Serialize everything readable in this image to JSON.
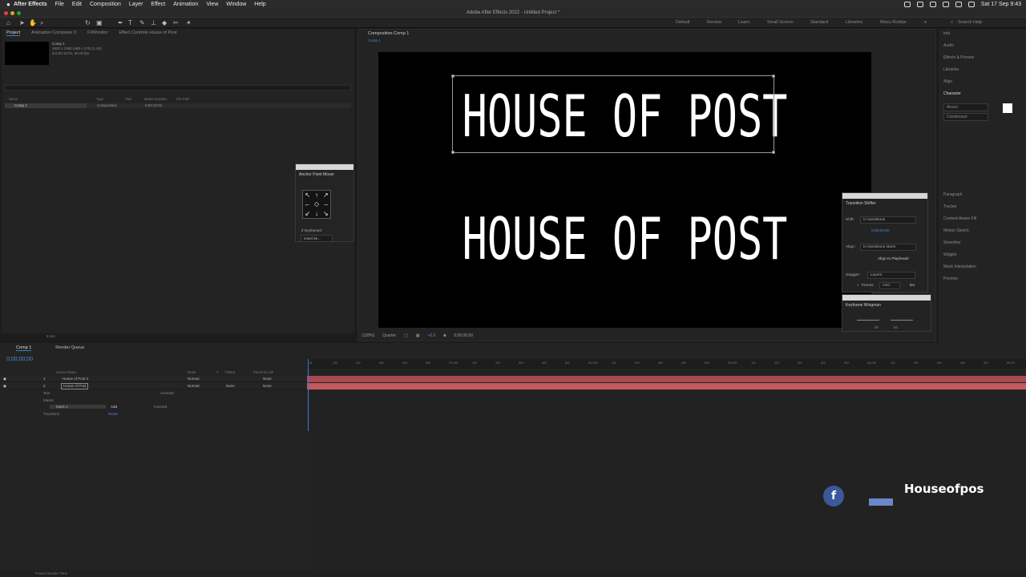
{
  "menubar": {
    "app": "After Effects",
    "items": [
      "File",
      "Edit",
      "Composition",
      "Layer",
      "Effect",
      "Animation",
      "View",
      "Window",
      "Help"
    ],
    "date": "Sat 17 Sep 9:43"
  },
  "window": {
    "title": "Adobe After Effects 2022 - Untitled Project *"
  },
  "workspaces": [
    "Default",
    "Review",
    "Learn",
    "Small Screen",
    "Standard",
    "Libraries",
    "Manu Roldán"
  ],
  "search_help": "Search Help",
  "project": {
    "tabs": [
      "Project",
      "Animation Composer 3",
      "FXMonitor",
      "Effect Controls House of Post"
    ],
    "item_name": "Comp 1",
    "meta1": "1920 x 1080 (480 x 270) (1,00)",
    "meta2": "Δ 0:00:10:01, 60,00 fps",
    "columns": [
      "Name",
      "Type",
      "Size",
      "Media Duration",
      "File Path"
    ],
    "row": {
      "name": "Comp 1",
      "type": "Composition",
      "duration": "0:00:10:01"
    },
    "bpc": "8 bpc"
  },
  "anchor_mover": {
    "title": "Anchor Point Mover",
    "label": "If keyframed:",
    "select": "Insert ke..."
  },
  "composition": {
    "tab": "Composition Comp 1",
    "subtab": "Comp 1",
    "text_top": "HOUSE OF POST",
    "text_bottom": "HOUSE OF POST",
    "zoom": "(128%)",
    "resolution": "Quarter",
    "exposure": "+0,0",
    "timecode": "0;00;00;00"
  },
  "shifter": {
    "title": "Transition Shifter",
    "shift_label": "Shift:",
    "shift_value": "In transitions",
    "time": "0;00;00;00",
    "align_label": "Align:",
    "align_value": "In transitions starts",
    "align_button": "Align to Playhead!",
    "stagger_label": "Stagger:",
    "stagger_value": "Layers",
    "frames": "1",
    "frames_label": "frames",
    "order": "ASC",
    "do": "Do"
  },
  "wingman": {
    "title": "Keyframe Wingman",
    "left_value": "60",
    "right_value": "60"
  },
  "right_panels": [
    "Info",
    "Audio",
    "Effects & Presets",
    "Libraries",
    "Align",
    "Character",
    "Paragraph",
    "Tracker",
    "Content-Aware Fill",
    "Motion Sketch",
    "Smoother",
    "Wiggler",
    "Mask Interpolation",
    "Preview"
  ],
  "character": {
    "font": "Alvaro",
    "style": "Condensed"
  },
  "timeline": {
    "tabs": [
      "Comp 1",
      "Render Queue"
    ],
    "timecode": "0;00;00;00",
    "columns": [
      "Source Name",
      "Mode",
      "T",
      "TrkMat",
      "Parent & Link"
    ],
    "layers": [
      {
        "num": "1",
        "name": "House of Post 3",
        "mode": "Normal",
        "trkmat": "",
        "parent": "None"
      },
      {
        "num": "2",
        "name": "House of Post",
        "mode": "Normal",
        "trkmat": "None",
        "parent": "None"
      }
    ],
    "sub_text": "Text",
    "sub_animate": "Animate:",
    "sub_masks": "Masks",
    "mask_name": "Mask 1",
    "mask_mode": "Add",
    "mask_inverted": "Inverted",
    "sub_transform": "Transform",
    "reset": "Reset",
    "ruler": [
      "0f",
      "10f",
      "20f",
      "30f",
      "40f",
      "50f",
      "01:00f",
      "10f",
      "20f",
      "30f",
      "40f",
      "50f",
      "02:00f",
      "10f",
      "20f",
      "30f",
      "40f",
      "50f",
      "03:00f",
      "10f",
      "20f",
      "30f",
      "40f",
      "50f",
      "04:00f",
      "10f",
      "20f",
      "30f",
      "40f",
      "50f",
      "05:00"
    ]
  },
  "social": {
    "fb_icon": "f",
    "handle": "Houseofpos"
  },
  "status": {
    "text": "Frame Render Time"
  }
}
